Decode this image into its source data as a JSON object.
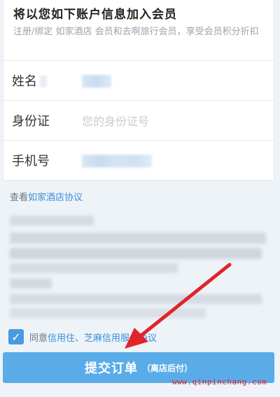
{
  "member": {
    "title": "将以您如下账户信息加入会员",
    "description": "注册/绑定  如家酒店  会员和去啊旅行会员，享受会员积分折扣"
  },
  "form": {
    "name_label": "姓名",
    "id_label": "身份证",
    "id_placeholder": "您的身份证号",
    "phone_label": "手机号"
  },
  "protocol": {
    "prefix": "查看",
    "link": "如家酒店协议"
  },
  "agreement": {
    "prefix": "同意",
    "link": "信用住、芝麻信用服务协议"
  },
  "submit": {
    "label": "提交订单",
    "sub_label": "（离店后付）"
  },
  "watermark": "www.qinpinchang.com",
  "colors": {
    "accent": "#5aace8",
    "link": "#3b8ed8",
    "arrow": "#e0242a",
    "background": "#eef3f8"
  }
}
